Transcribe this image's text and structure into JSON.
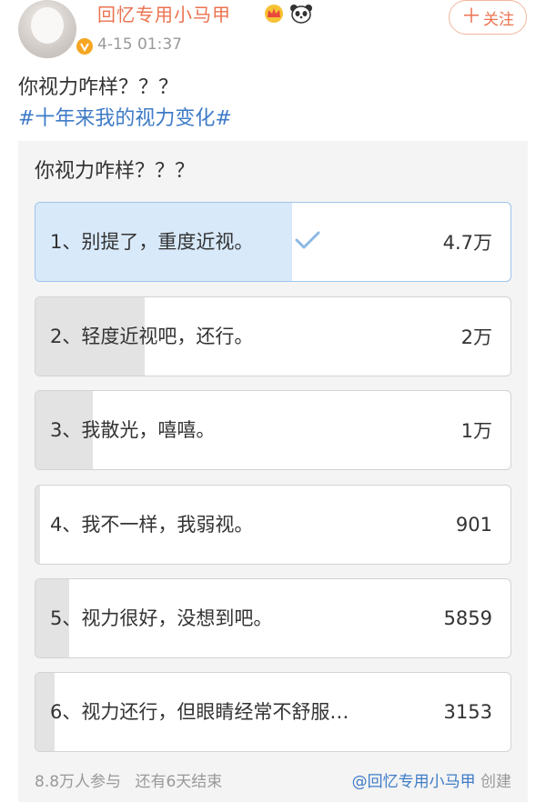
{
  "post": {
    "username": "回忆专用小马甲",
    "timestamp": "4-15 01:37",
    "follow_label": "关注",
    "text": "你视力咋样？？？",
    "hashtag": "#十年来我的视力变化#"
  },
  "poll": {
    "question": "你视力咋样？？？",
    "options": [
      {
        "label": "1、别提了，重度近视。",
        "count": "4.7万",
        "share": 0.54,
        "voted": true
      },
      {
        "label": "2、轻度近视吧，还行。",
        "count": "2万",
        "share": 0.23,
        "voted": false
      },
      {
        "label": "3、我散光，嘻嘻。",
        "count": "1万",
        "share": 0.12,
        "voted": false
      },
      {
        "label": "4、我不一样，我弱视。",
        "count": "901",
        "share": 0.01,
        "voted": false
      },
      {
        "label": "5、视力很好，没想到吧。",
        "count": "5859",
        "share": 0.07,
        "voted": false
      },
      {
        "label": "6、视力还行，但眼睛经常不舒服…",
        "count": "3153",
        "share": 0.04,
        "voted": false
      }
    ],
    "participants": "8.8万人参与",
    "remaining": "还有6天结束",
    "creator": "@回忆专用小马甲",
    "created_label": "创建"
  },
  "colors": {
    "username": "#eb7350",
    "hashtag": "#3e7bc7",
    "voted_fill": "#d8e9fa",
    "fill": "#e3e3e3"
  },
  "icons": [
    "avatar",
    "verified-badge-icon",
    "crown-icon",
    "panda-icon",
    "plus-icon",
    "check-icon"
  ]
}
